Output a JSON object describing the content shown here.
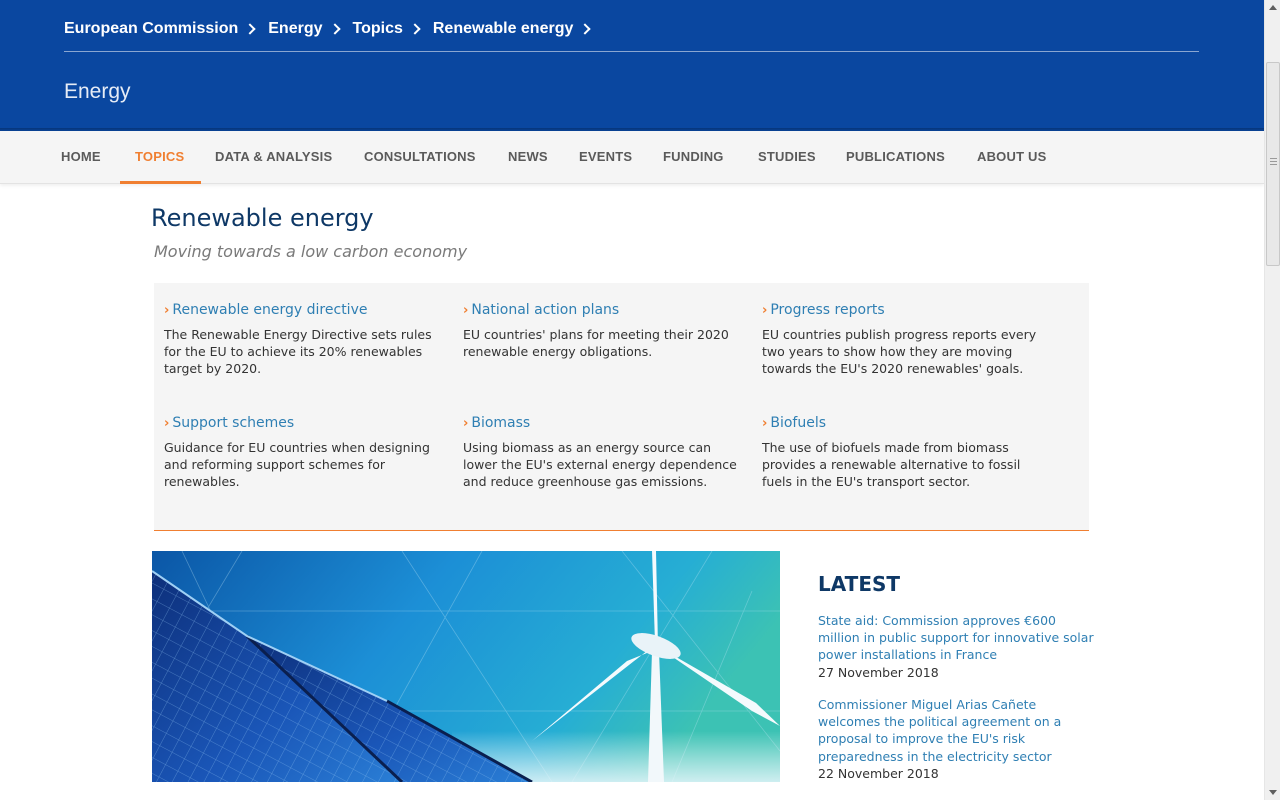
{
  "breadcrumb": [
    "European Commission",
    "Energy",
    "Topics",
    "Renewable energy"
  ],
  "site_name": "Energy",
  "nav": [
    "HOME",
    "TOPICS",
    "DATA & ANALYSIS",
    "CONSULTATIONS",
    "NEWS",
    "EVENTS",
    "FUNDING",
    "STUDIES",
    "PUBLICATIONS",
    "ABOUT US"
  ],
  "nav_active": "TOPICS",
  "page": {
    "title": "Renewable energy",
    "subtitle": "Moving towards a low carbon economy"
  },
  "topics": [
    {
      "title": "Renewable energy directive",
      "desc": "The Renewable Energy Directive sets rules for the EU to achieve its 20% renewables target by 2020."
    },
    {
      "title": "National action plans",
      "desc": "EU countries' plans for meeting their 2020 renewable energy obligations."
    },
    {
      "title": "Progress reports",
      "desc": "EU countries publish progress reports every two years to show how they are moving towards the EU's 2020 renewables' goals."
    },
    {
      "title": "Support schemes",
      "desc": "Guidance for EU countries when designing and reforming support schemes for renewables."
    },
    {
      "title": "Biomass",
      "desc": "Using biomass as an energy source can lower the EU's external energy dependence and reduce greenhouse gas emissions."
    },
    {
      "title": "Biofuels",
      "desc": "The use of biofuels made from biomass provides a renewable alternative to fossil fuels in the EU's transport sector."
    }
  ],
  "latest": {
    "title": "LATEST",
    "items": [
      {
        "title": "State aid: Commission approves €600 million in public support for innovative solar power installations in France",
        "date": "27 November 2018"
      },
      {
        "title": "Commissioner Miguel Arias Cañete welcomes the political agreement on a proposal to improve the EU's risk preparedness in the electricity sector",
        "date": "22 November 2018"
      }
    ]
  },
  "icons": {
    "breadcrumb_separator": "chevron-right-icon",
    "topic_bullet": "chevron-right-icon"
  },
  "colors": {
    "header_blue": "#0a47a0",
    "accent_orange": "#f07f31",
    "link_blue": "#2f7fb3",
    "title_navy": "#0e3866"
  }
}
